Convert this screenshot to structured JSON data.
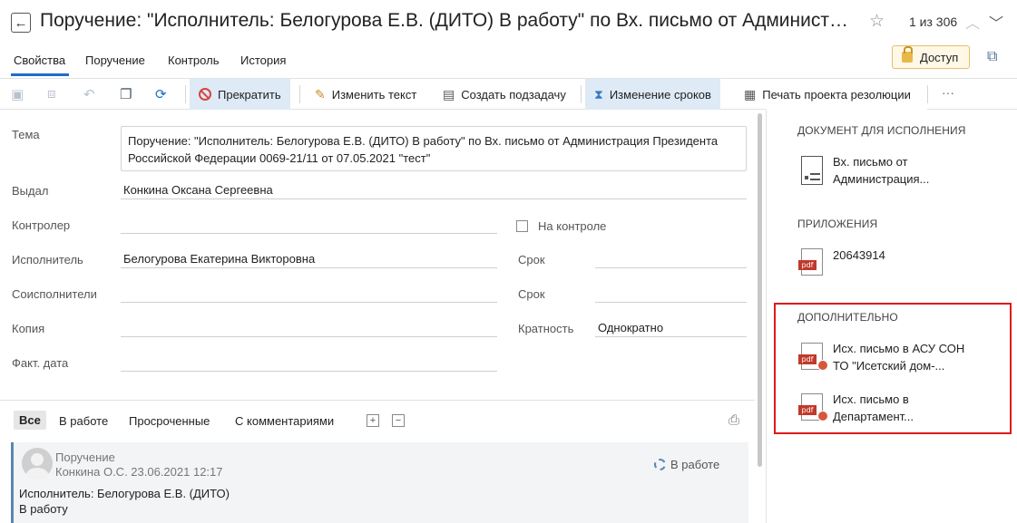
{
  "header": {
    "back_icon": "arrow-left-icon",
    "title": "Поручение: \"Исполнитель: Белогурова Е.В. (ДИТО) В работу\" по Вх. письмо от Администрация Президента Российской Федерации 0069-21/11 от 07.05.2021 \"тест\"",
    "pager": "1 из 306"
  },
  "tabs": [
    {
      "label": "Свойства",
      "active": true
    },
    {
      "label": "Поручение"
    },
    {
      "label": "Контроль"
    },
    {
      "label": "История"
    }
  ],
  "access_button": "Доступ",
  "toolbar": {
    "stop": "Прекратить",
    "edit_text": "Изменить текст",
    "create_subtask": "Создать подзадачу",
    "change_deadlines": "Изменение сроков",
    "print_resolution": "Печать проекта резолюции",
    "more": "···"
  },
  "form": {
    "tema_label": "Тема",
    "tema_value": "Поручение: \"Исполнитель: Белогурова Е.В. (ДИТО) В работу\" по Вх. письмо от Администрация Президента Российской Федерации 0069-21/11 от 07.05.2021 \"тест\"",
    "vydal_label": "Выдал",
    "vydal_value": "Конкина Оксана Сергеевна",
    "controller_label": "Контролер",
    "controller_value": "",
    "on_control_label": "На контроле",
    "executor_label": "Исполнитель",
    "executor_value": "Белогурова Екатерина Викторовна",
    "srok1_label": "Срок",
    "srok1_value": "",
    "coexec_label": "Соисполнители",
    "coexec_value": "",
    "srok2_label": "Срок",
    "srok2_value": "",
    "copy_label": "Копия",
    "copy_value": "",
    "frequency_label": "Кратность",
    "frequency_value": "Однократно",
    "fact_date_label": "Факт. дата",
    "fact_date_value": ""
  },
  "filter": {
    "tabs": [
      "Все",
      "В работе",
      "Просроченные",
      "С комментариями"
    ],
    "expand": "+",
    "collapse": "−"
  },
  "card": {
    "type": "Поручение",
    "author_date": "Конкина О.С.  23.06.2021 12:17",
    "status": "В работе",
    "line1": "Исполнитель: Белогурова Е.В. (ДИТО)",
    "line2": "В работу"
  },
  "right_panel": {
    "doc_heading": "ДОКУМЕНТ ДЛЯ ИСПОЛНЕНИЯ",
    "doc_line1": "Вх. письмо от",
    "doc_line2": "Администрация...",
    "attachments_heading": "ПРИЛОЖЕНИЯ",
    "attachment_name": "20643914",
    "additional_heading": "ДОПОЛНИТЕЛЬНО",
    "add1_line1": "Исх. письмо в АСУ СОН",
    "add1_line2": "ТО \"Исетский дом-...",
    "add2_line1": "Исх. письмо в",
    "add2_line2": "Департамент..."
  },
  "pdf_label": "pdf",
  "colors": {
    "accent": "#1e6fc8",
    "highlight": "#deeaf6",
    "red_frame": "#e01919",
    "pdf": "#c0392b"
  }
}
